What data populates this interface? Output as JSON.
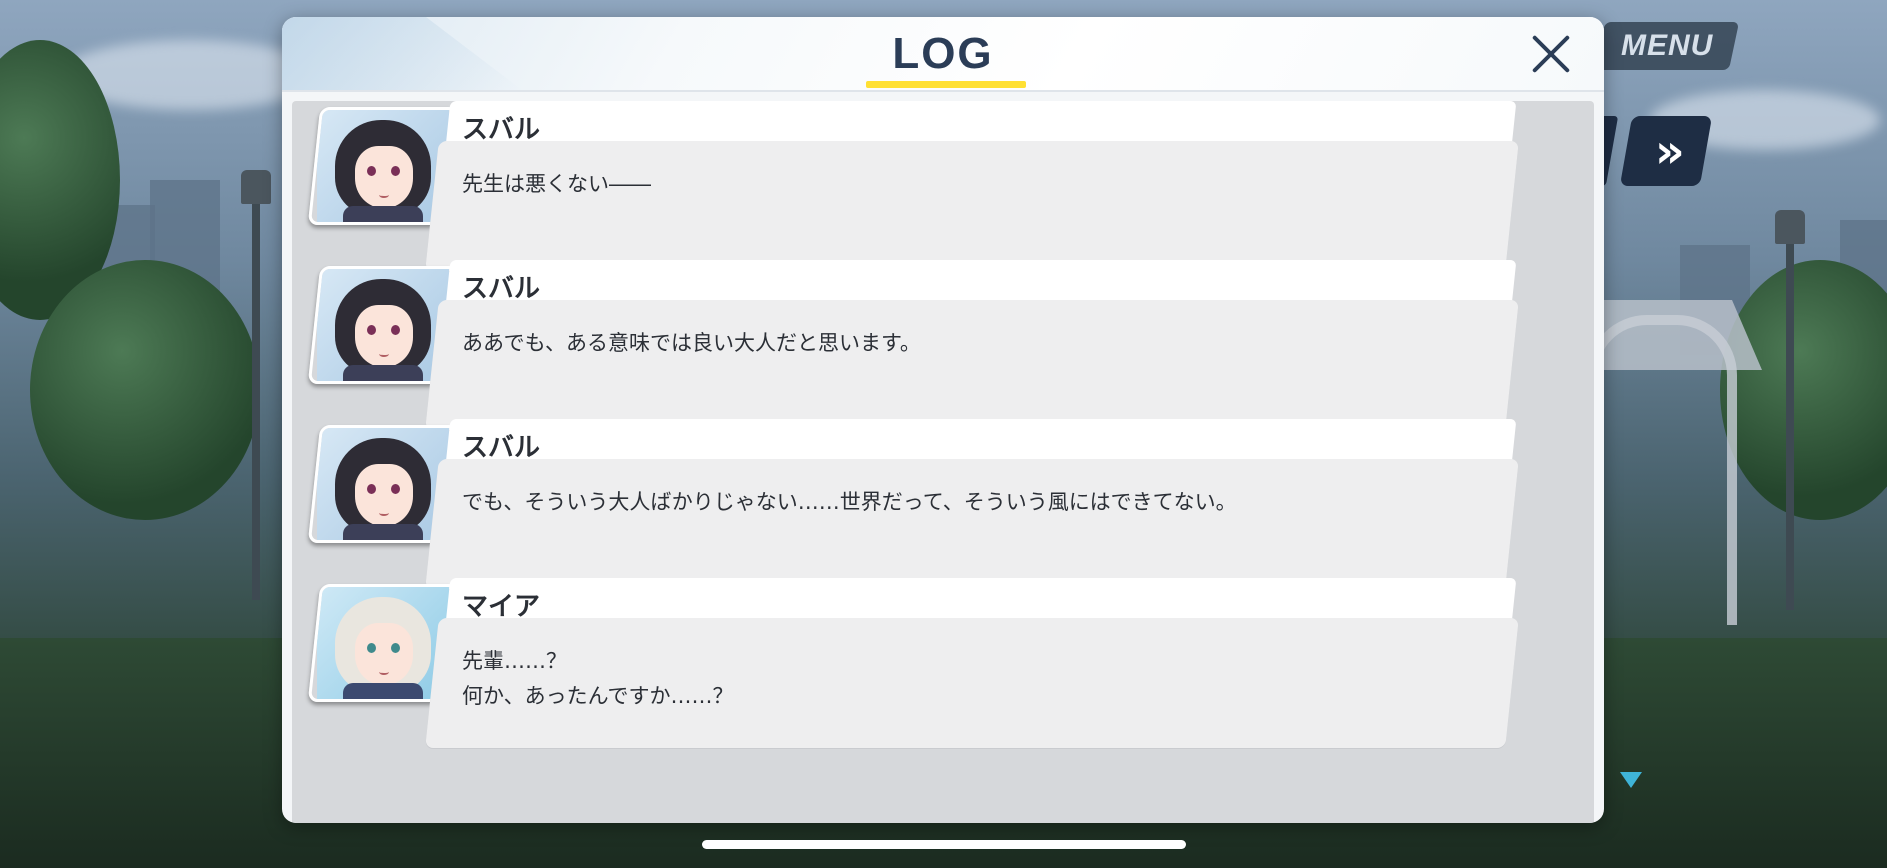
{
  "header": {
    "title": "LOG"
  },
  "controls": {
    "menu_label": "MENU",
    "fast_forward_label": "»"
  },
  "log": [
    {
      "speaker": "スバル",
      "text": "先生は悪くない――",
      "avatar": "subaru-portrait"
    },
    {
      "speaker": "スバル",
      "text": "ああでも、ある意味では良い大人だと思います。",
      "avatar": "subaru-portrait"
    },
    {
      "speaker": "スバル",
      "text": "でも、そういう大人ばかりじゃない……世界だって、そういう風にはできてない。",
      "avatar": "subaru-portrait"
    },
    {
      "speaker": "マイア",
      "text": "先輩……？\n何か、あったんですか……？",
      "avatar": "maia-portrait"
    }
  ],
  "colors": {
    "title": "#2b3d57",
    "accent_underline": "#ffe033",
    "bubble": "#eeeeef",
    "panel": "#f4f6f8"
  }
}
